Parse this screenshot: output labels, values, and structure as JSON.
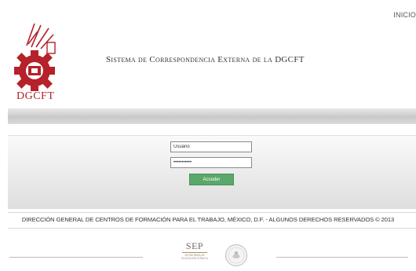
{
  "header": {
    "inicio_label": "INICIO",
    "logo_text": "DGCFT",
    "system_title": "Sistema de Correspondencia Externa de la DGCFT"
  },
  "login": {
    "user_value": "Usuario",
    "password_value": "•••••••••••",
    "submit_label": "Acceder"
  },
  "footer": {
    "copyright": "DIRECCIÓN GENERAL DE CENTROS DE FORMACIÓN PARA EL TRABAJO, MÉXICO, D.F. - ALGUNOS DERECHOS RESERVADOS © 2013",
    "sep_label": "SEP",
    "sep_sub1": "SECRETARÍA DE",
    "sep_sub2": "EDUCACIÓN PÚBLICA"
  },
  "colors": {
    "brand_red": "#b5222a",
    "button_green": "#5aa86a"
  },
  "icons": {
    "logo": "dgcft-gear-logo",
    "seal": "mexico-coat-of-arms"
  }
}
